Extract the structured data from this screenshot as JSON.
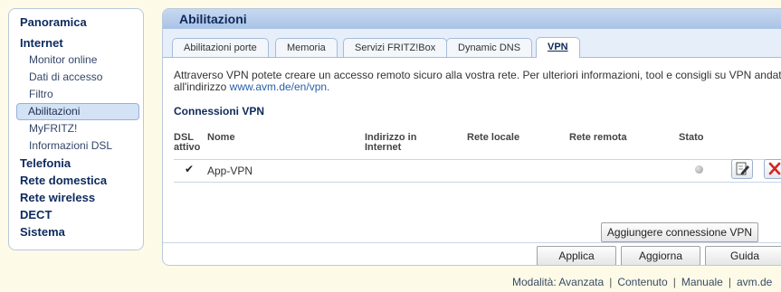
{
  "sidebar": {
    "items": [
      {
        "label": "Panoramica",
        "level": "top"
      },
      {
        "label": "Internet",
        "level": "top"
      },
      {
        "label": "Monitor online",
        "level": "sub"
      },
      {
        "label": "Dati di accesso",
        "level": "sub"
      },
      {
        "label": "Filtro",
        "level": "sub"
      },
      {
        "label": "Abilitazioni",
        "level": "sub",
        "active": true
      },
      {
        "label": "MyFRITZ!",
        "level": "sub"
      },
      {
        "label": "Informazioni DSL",
        "level": "sub"
      },
      {
        "label": "Telefonia",
        "level": "top"
      },
      {
        "label": "Rete domestica",
        "level": "top"
      },
      {
        "label": "Rete wireless",
        "level": "top"
      },
      {
        "label": "DECT",
        "level": "top"
      },
      {
        "label": "Sistema",
        "level": "top"
      }
    ]
  },
  "main": {
    "title": "Abilitazioni",
    "tabs": [
      {
        "label": "Abilitazioni porte"
      },
      {
        "label": "Memoria"
      },
      {
        "label": "Servizi FRITZ!Box"
      },
      {
        "label": "Dynamic DNS"
      },
      {
        "label": "VPN",
        "active": true
      }
    ],
    "intro_text": "Attraverso VPN potete creare un accesso remoto sicuro alla vostra rete. Per ulteriori informazioni, tool e consigli su VPN andate all'indirizzo ",
    "intro_link": "www.avm.de/en/vpn.",
    "section_title": "Connessioni VPN",
    "columns": {
      "dsl_active": "DSL attivo",
      "name": "Nome",
      "internet_address": "Indirizzo in Internet",
      "local_network": "Rete locale",
      "remote_network": "Rete remota",
      "status": "Stato"
    },
    "rows": [
      {
        "checked": true,
        "checkmark": "✔",
        "name": "App-VPN",
        "internet_address": "",
        "local_network": "",
        "remote_network": ""
      }
    ],
    "add_button": "Aggiungere connessione VPN",
    "buttons": {
      "apply": "Applica",
      "refresh": "Aggiorna",
      "help": "Guida"
    }
  },
  "footer": {
    "mode": "Modalità: Avanzata",
    "contents": "Contenuto",
    "manual": "Manuale",
    "site": "avm.de",
    "separator": "|"
  },
  "colors": {
    "page_background": "#fdfbe8",
    "header_blue": "#a9c3e6",
    "title_text": "#0e2a5a",
    "link": "#2a5ea8",
    "delete_red": "#d8231e"
  },
  "icons": {
    "edit": "edit-icon",
    "delete": "delete-icon",
    "status": "status-dot-icon"
  }
}
